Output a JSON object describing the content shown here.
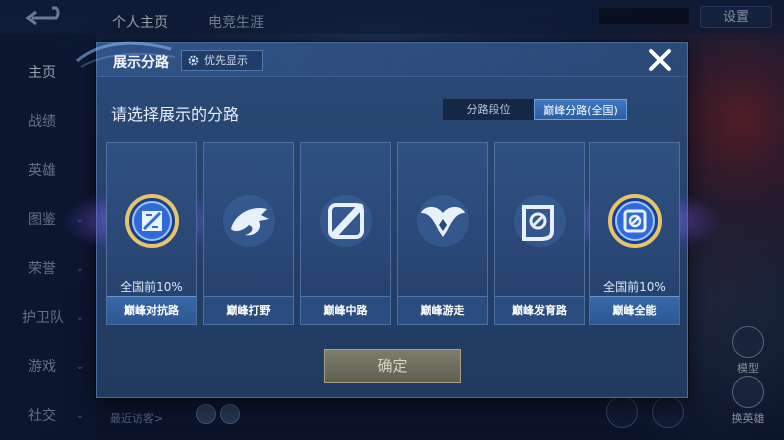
{
  "background": {
    "top_tabs": [
      "个人主页",
      "电竞生涯"
    ],
    "settings_label": "设置",
    "sidebar": [
      {
        "label": "主页"
      },
      {
        "label": "战绩"
      },
      {
        "label": "英雄"
      },
      {
        "label": "图鉴"
      },
      {
        "label": "荣誉"
      },
      {
        "label": "护卫队"
      },
      {
        "label": "游戏"
      },
      {
        "label": "社交"
      }
    ],
    "recent_visitors_label": "最近访客>",
    "right_buttons": [
      {
        "label": "模型"
      },
      {
        "label": "换英雄"
      }
    ]
  },
  "modal": {
    "title": "展示分路",
    "priority_button": "优先显示",
    "close_icon": "close-icon",
    "subtitle": "请选择展示的分路",
    "segments": [
      {
        "label": "分路段位",
        "selected": false
      },
      {
        "label": "巅峰分路(全国)",
        "selected": true
      }
    ],
    "roles": [
      {
        "name": "巅峰对抗路",
        "rank": "全国前10%",
        "icon": "shield-sword-icon",
        "highlighted": true
      },
      {
        "name": "巅峰打野",
        "rank": "",
        "icon": "dragon-icon",
        "highlighted": false
      },
      {
        "name": "巅峰中路",
        "rank": "",
        "icon": "staff-icon",
        "highlighted": false
      },
      {
        "name": "巅峰游走",
        "rank": "",
        "icon": "wings-icon",
        "highlighted": false
      },
      {
        "name": "巅峰发育路",
        "rank": "",
        "icon": "bow-icon",
        "highlighted": false
      },
      {
        "name": "巅峰全能",
        "rank": "全国前10%",
        "icon": "all-round-icon",
        "highlighted": true
      }
    ],
    "confirm_label": "确定"
  },
  "colors": {
    "modal_bg": "#264470",
    "accent_blue": "#3f79c4",
    "confirm_disabled": "#6d6e5c",
    "glow_purple": "#7d6cff"
  }
}
